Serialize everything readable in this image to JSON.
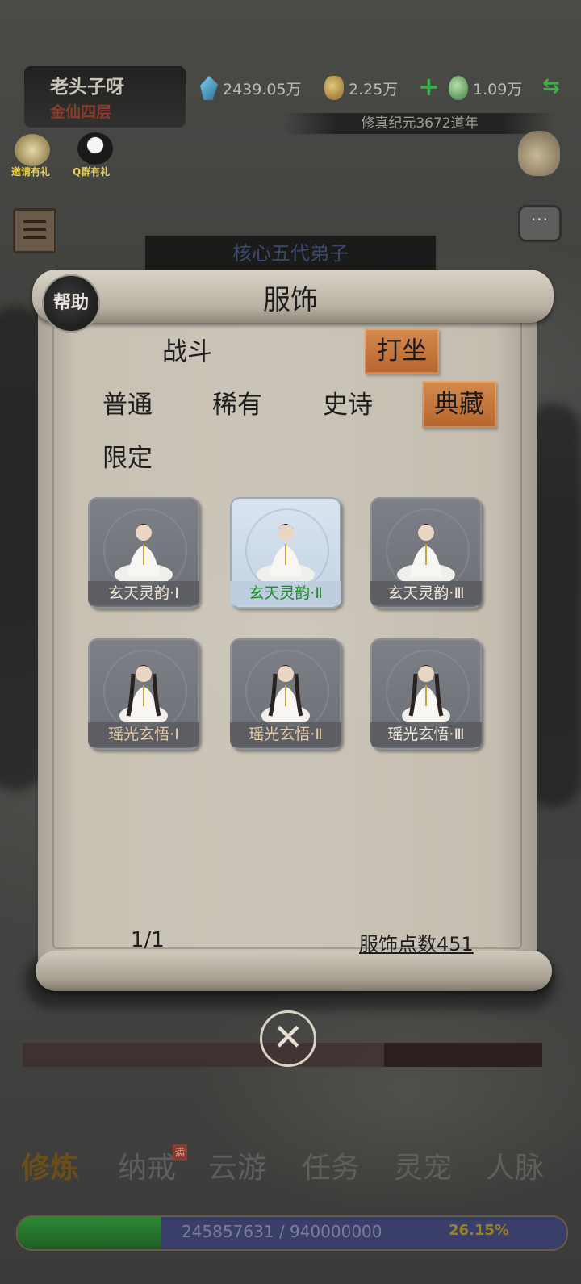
{
  "header": {
    "player_name": "老头子呀",
    "player_rank": "金仙四层",
    "resources": [
      {
        "icon": "spirit-stone-icon",
        "value": "2439.05万"
      },
      {
        "icon": "gold-pouch-icon",
        "value": "2.25万"
      },
      {
        "icon": "jade-gourd-icon",
        "value": "1.09万"
      }
    ],
    "era": "修真纪元3672道年",
    "side_buttons": [
      "邀请有礼",
      "Q群有礼"
    ],
    "chat_label": "···"
  },
  "background": {
    "disciple_banner": "核心五代弟子"
  },
  "dialog": {
    "help_label": "帮助",
    "title": "服饰",
    "mode_tabs": [
      {
        "label": "战斗",
        "active": false
      },
      {
        "label": "打坐",
        "active": true
      }
    ],
    "rarity_tabs": [
      {
        "label": "普通",
        "active": false
      },
      {
        "label": "稀有",
        "active": false
      },
      {
        "label": "史诗",
        "active": false
      },
      {
        "label": "典藏",
        "active": true
      },
      {
        "label": "限定",
        "active": false
      }
    ],
    "costumes": [
      {
        "name": "玄天灵韵·Ⅰ",
        "selected": false
      },
      {
        "name": "玄天灵韵·Ⅱ",
        "selected": true
      },
      {
        "name": "玄天灵韵·Ⅲ",
        "selected": false
      },
      {
        "name": "瑶光玄悟·Ⅰ",
        "selected": false
      },
      {
        "name": "瑶光玄悟·Ⅱ",
        "selected": false
      },
      {
        "name": "瑶光玄悟·Ⅲ",
        "selected": false
      }
    ],
    "page_indicator": "1/1",
    "costume_points": "服饰点数451",
    "close_icon": "close-circle-icon"
  },
  "bottom_nav": {
    "items": [
      {
        "label": "修炼",
        "active": true
      },
      {
        "label": "纳戒",
        "active": false
      },
      {
        "label": "云游",
        "active": false
      },
      {
        "label": "任务",
        "active": false
      },
      {
        "label": "灵宠",
        "active": false
      },
      {
        "label": "人脉",
        "active": false
      }
    ],
    "badge": "满"
  },
  "experience": {
    "text": "245857631 / 940000000",
    "percent": "26.15%",
    "fraction": 0.2615
  }
}
